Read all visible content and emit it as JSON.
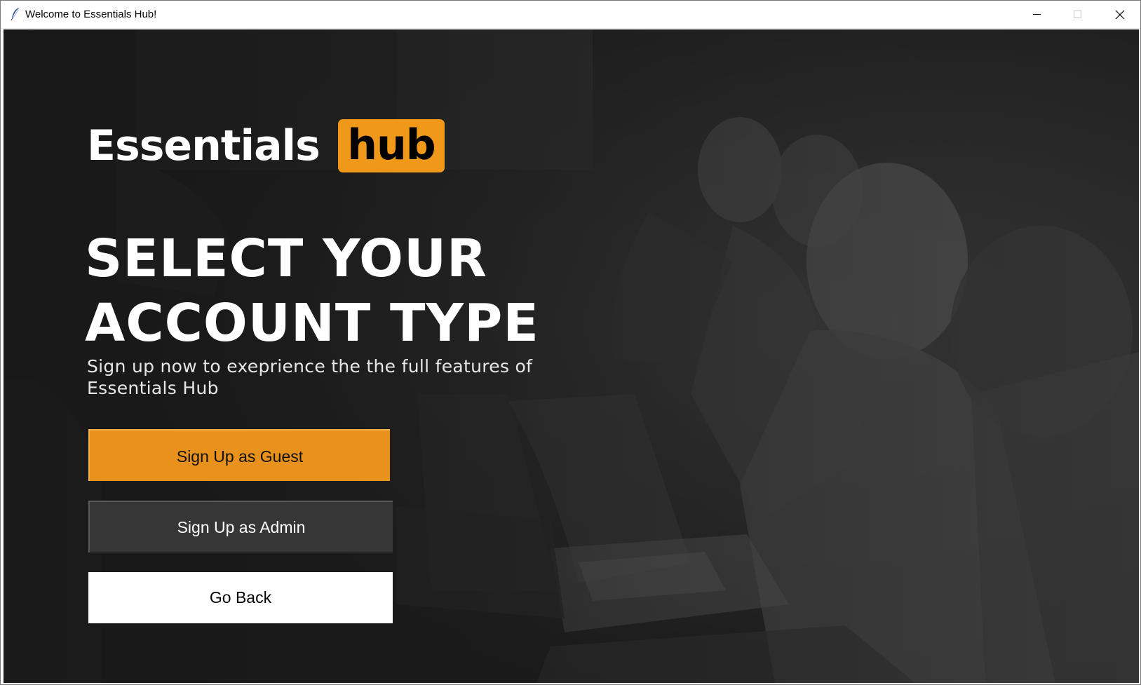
{
  "window": {
    "title": "Welcome to Essentials Hub!",
    "app_icon": "feather-icon",
    "controls": [
      "minimize-icon",
      "maximize-icon",
      "close-icon"
    ]
  },
  "logo": {
    "text": "Essentials",
    "badge": "hub"
  },
  "heading": {
    "line1": "SELECT YOUR",
    "line2": "ACCOUNT TYPE"
  },
  "subtitle": {
    "line1": "Sign up now to exeprience the the full features of",
    "line2": "Essentials Hub"
  },
  "buttons": {
    "guest": "Sign Up as Guest",
    "admin": "Sign Up as Admin",
    "back": "Go Back"
  },
  "colors": {
    "accent": "#e8911c",
    "background": "#1f1f1f",
    "admin_button": "#363636",
    "back_button": "#ffffff"
  }
}
